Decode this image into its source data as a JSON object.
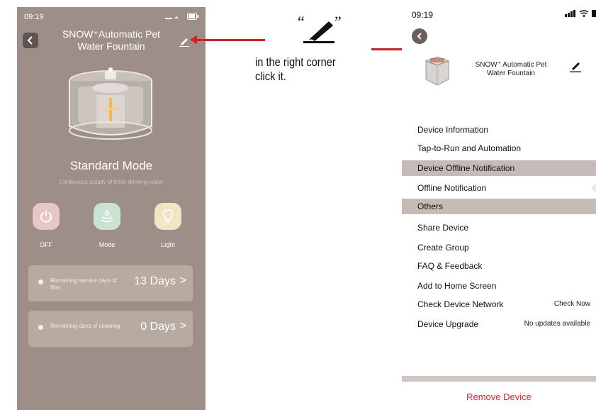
{
  "left_phone": {
    "status_time": "09:19",
    "title_line1": "SNOW⁺Automatic Pet",
    "title_line2": "Water Fountain",
    "mode_title": "Standard Mode",
    "mode_subtitle": "Continuous supply of fresh drinking water",
    "controls": [
      {
        "label": "OFF",
        "icon": "power-icon"
      },
      {
        "label": "Mode",
        "icon": "fountain-mode-icon"
      },
      {
        "label": "Light",
        "icon": "lightbulb-icon"
      }
    ],
    "filter_card": {
      "desc": "Remaining service days of filter",
      "value": "13 Days",
      "chevron": ">"
    },
    "clean_card": {
      "desc": "Remaining days of cleaning",
      "value": "0 Days",
      "chevron": ">"
    }
  },
  "annotation": {
    "quote_open": "“",
    "quote_close": "”",
    "line1": "in the right corner",
    "line2": "click it.",
    "arrow_color": "#e0191f"
  },
  "right_phone": {
    "status_time": "09:19",
    "title_line1": "SNOW⁺ Automatic Pet",
    "title_line2": "Water Fountain",
    "menu": {
      "device_information": "Device Information",
      "tap_to_run": "Tap-to-Run and Automation",
      "offline_section": "Device Offline Notification",
      "offline_notification": "Offline Notification",
      "others_section": "Others",
      "share_device": "Share Device",
      "create_group": "Create Group",
      "faq": "FAQ & Feedback",
      "add_home": "Add to Home Screen",
      "check_network": "Check Device Network",
      "check_network_value": "Check Now",
      "device_upgrade": "Device Upgrade",
      "device_upgrade_value": "No updates available"
    },
    "remove_device": "Remove Device"
  },
  "colors": {
    "left_bg": "#9d8f87",
    "card_bg": "#b7aaa0",
    "section_bg": "#c6bab6",
    "danger": "#d9232e"
  }
}
